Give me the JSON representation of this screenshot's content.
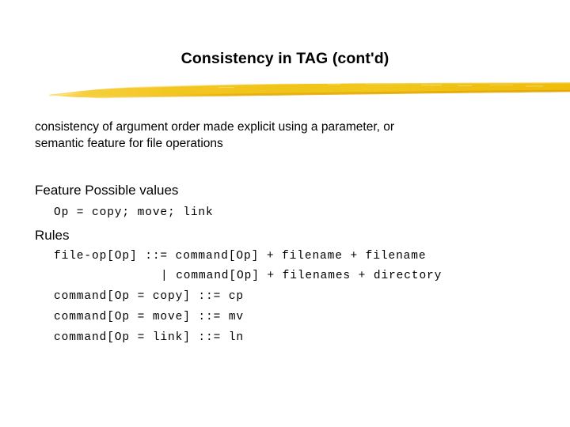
{
  "slide": {
    "title": "Consistency in TAG (cont'd)",
    "accent_color": "#f0c419",
    "accent_color_light": "#fbe07a",
    "accent_color_dark": "#e0a80d",
    "background_color": "#ffffff",
    "text_color": "#000000",
    "divider_icon": "brushstroke-divider",
    "body": {
      "line1": "consistency of argument order made explicit using a parameter, or",
      "line2": "semantic feature for file operations"
    },
    "sections": [
      {
        "heading": "Feature Possible values",
        "lines": [
          "Op = copy; move; link"
        ]
      },
      {
        "heading": "Rules",
        "lines": [
          "file-op[Op] ::= command[Op] + filename + filename",
          "| command[Op] + filenames + directory",
          "command[Op = copy] ::= cp",
          "command[Op = move] ::= mv",
          "command[Op = link] ::= ln"
        ]
      }
    ]
  }
}
